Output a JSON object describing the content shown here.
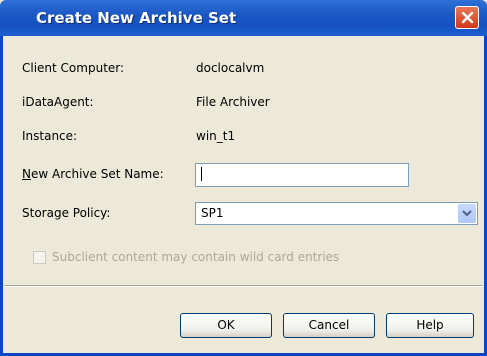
{
  "window": {
    "title": "Create New Archive Set"
  },
  "fields": {
    "client_computer": {
      "label": "Client Computer:",
      "value": "doclocalvm"
    },
    "idataagent": {
      "label": "iDataAgent:",
      "value": "File Archiver"
    },
    "instance": {
      "label": "Instance:",
      "value": "win_t1"
    },
    "archive_set_name": {
      "label_mnemonic": "N",
      "label_rest": "ew Archive Set Name:",
      "value": ""
    },
    "storage_policy": {
      "label": "Storage Policy:",
      "selected": "SP1"
    }
  },
  "checkbox": {
    "label": "Subclient content may contain wild card entries",
    "checked": false,
    "enabled": false
  },
  "buttons": {
    "ok": "OK",
    "cancel": "Cancel",
    "help": "Help"
  },
  "colors": {
    "titlebar": "#1450bf",
    "dialog_bg": "#ece9d8",
    "close": "#cf3a1a"
  },
  "icons": {
    "close": "close-icon",
    "dropdown": "chevron-down-icon"
  }
}
